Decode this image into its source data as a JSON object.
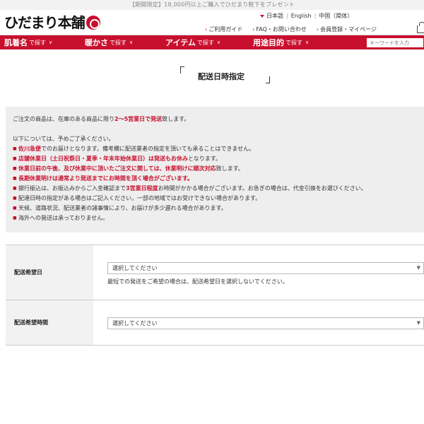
{
  "promo": "【期間限定】18,000円以上ご購入でひだまり靴下をプレゼント",
  "logo": {
    "text": "ひだまり本舗"
  },
  "languages": [
    "日本語",
    "English",
    "中国（简体）"
  ],
  "utility_links": [
    "ご利用ガイド",
    "FAQ・お問い合わせ",
    "会員登録・マイページ"
  ],
  "nav": {
    "items": [
      {
        "big": "肌着名",
        "small": "で探す"
      },
      {
        "big": "暖かさ",
        "small": "で探す"
      },
      {
        "big": "アイテム",
        "small": "で探す"
      },
      {
        "big": "用途目的",
        "small": "で探す"
      }
    ],
    "search_placeholder": "キーワードを入力"
  },
  "page_title": "配送日時指定",
  "notice": {
    "p1_pre": "ご注文の商品は、在庫のある商品に限り",
    "p1_red": "2～5営業日で発送",
    "p1_post": "致します。",
    "p2": "以下については、予めご了承ください。",
    "items": [
      {
        "red": "佐川急便",
        "text": "でのお届けとなります。備考欄に配送業者の指定を頂いても承ることはできません。"
      },
      {
        "red": "店舗休業日（土日祝祭日・夏季・年末年始休業日）は発送もお休み",
        "text": "となります。"
      },
      {
        "red": "休業日前の午後、及び休業中に頂いたご注文に関しては、休業明けに順次対応",
        "text": "致します。"
      },
      {
        "full_red": "長期休業明けは通常より発送までにお時間を頂く場合がございます。"
      },
      {
        "pre": "銀行振込は、お振込みからご入金確認まで",
        "red": "3営業日程度",
        "text": "お時間がかかる場合がございます。お急ぎの場合は、代金引換をお選びください。"
      },
      {
        "text": "配達日時の指定がある場合はご記入ください。一部の地域ではお受けできない場合があります。"
      },
      {
        "text": "天候、道路状況、配送業者の諸事情により、お届けが多少遅れる場合があります。"
      },
      {
        "text": "海外への発送は承っておりません。"
      }
    ]
  },
  "form": {
    "date_label": "配送希望日",
    "date_select": "選択してください",
    "date_hint": "最短での発送をご希望の場合は、配送希望日を選択しないでください。",
    "time_label": "配送希望時間",
    "time_select": "選択してください"
  },
  "colors": {
    "accent": "#c8102e",
    "notice_bg": "#eeeeee",
    "label_bg": "#f2f2f2"
  }
}
